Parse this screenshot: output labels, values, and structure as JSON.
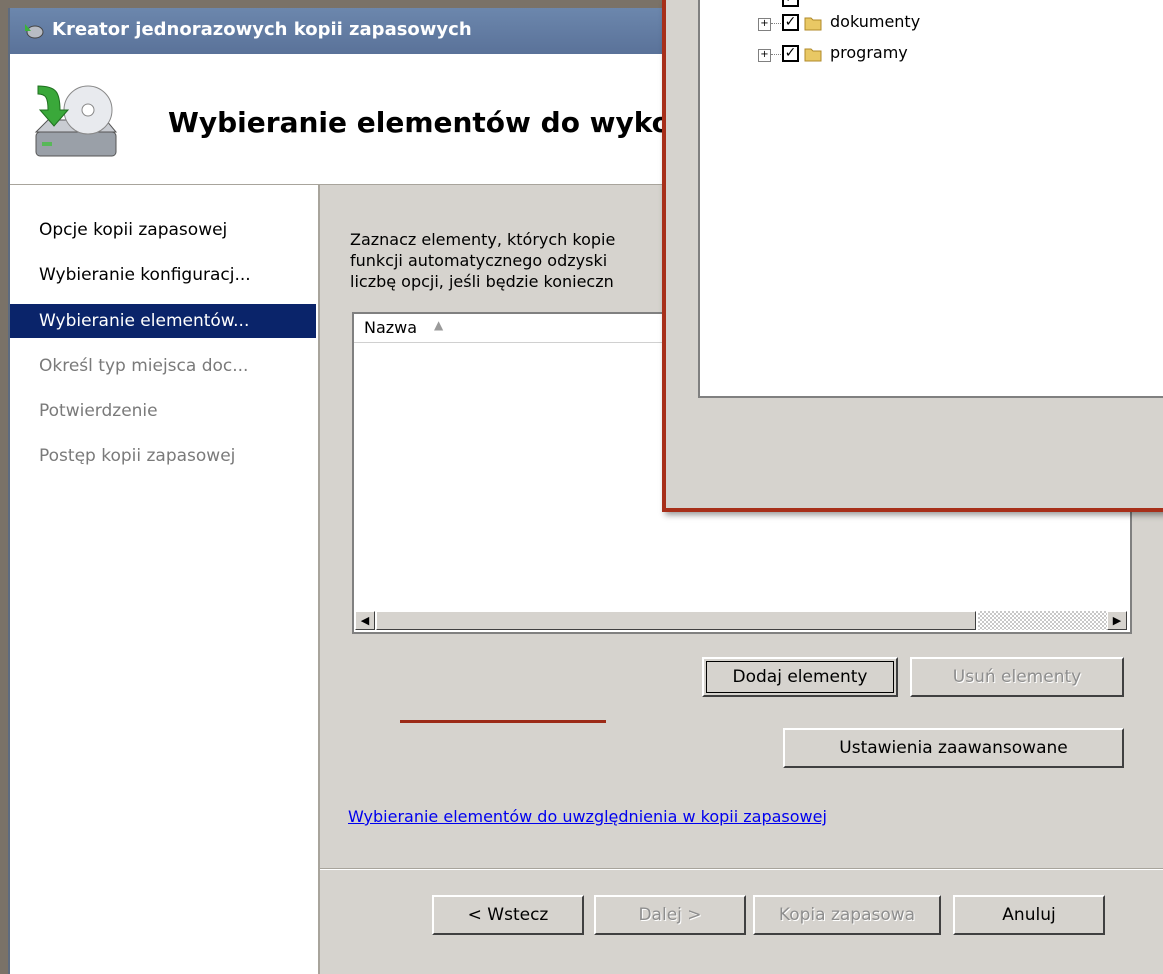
{
  "window": {
    "title": "Kreator jednorazowych kopii zapasowych"
  },
  "header": {
    "title": "Wybieranie elementów do wykonania"
  },
  "nav": {
    "items": [
      {
        "label": "Opcje kopii zapasowej"
      },
      {
        "label": "Wybieranie konfiguracj..."
      },
      {
        "label": "Wybieranie elementów..."
      },
      {
        "label": "Określ typ miejsca doc..."
      },
      {
        "label": "Potwierdzenie"
      },
      {
        "label": "Postęp kopii zapasowej"
      }
    ]
  },
  "content": {
    "description_lines": [
      "Zaznacz elementy, których kopie",
      "funkcji automatycznego odzyski",
      "liczbę opcji, jeśli będzie konieczn"
    ],
    "list_column": "Nazwa",
    "add_button": "Dodaj elementy",
    "remove_button": "Usuń elementy",
    "advanced_button": "Ustawienia zaawansowane",
    "help_link": "Wybieranie elementów do uwzględnienia w kopii zapasowej"
  },
  "footer": {
    "back": "< Wstecz",
    "next": "Dalej >",
    "backup": "Kopia zapasowa",
    "cancel": "Anuluj"
  },
  "popup": {
    "tree_items": [
      {
        "label": "dokumenty",
        "checked": true
      },
      {
        "label": "programy",
        "checked": true
      }
    ]
  },
  "colors": {
    "selection": "#0a246a",
    "highlight": "#a72f1a",
    "link": "#0000ee"
  }
}
